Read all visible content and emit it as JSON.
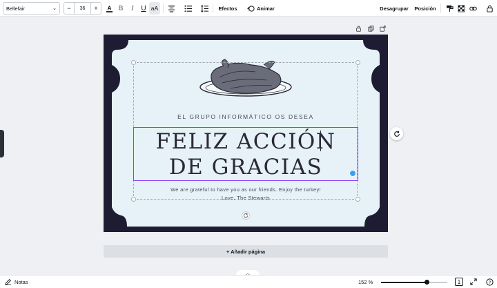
{
  "toolbar": {
    "font_name": "Bellefair",
    "font_size": "36",
    "decrease": "−",
    "increase": "+",
    "bold": "B",
    "italic": "I",
    "underline": "U",
    "case": "aA",
    "effects_label": "Efectos",
    "animate_label": "Animar",
    "ungroup_label": "Desagrupar",
    "position_label": "Posición",
    "icons": [
      "text-color-icon",
      "align-center-icon",
      "bulleted-list-icon",
      "line-spacing-icon",
      "animate-icon",
      "paint-format-icon",
      "transparency-icon",
      "link-icon",
      "lock-icon"
    ]
  },
  "canvas": {
    "subtitle": "EL GRUPO INFORMÁTICO OS DESEA",
    "title_line1": "FELIZ ACCIÓN",
    "title_line2": "DE GRACIAS",
    "message_line1": "We are grateful to have you as our friends. Enjoy the turkey!",
    "message_line2": "Love, The Stewarts",
    "page_icons": [
      "lock-icon",
      "duplicate-icon",
      "add-page-icon"
    ],
    "card_colors": {
      "border": "#1e1c33",
      "panel": "#e6f1f8"
    }
  },
  "add_page_label": "+ Añadir página",
  "bottombar": {
    "notes_label": "Notas",
    "zoom_label": "152 %",
    "zoom_fraction": 0.69,
    "page_count": "1"
  }
}
